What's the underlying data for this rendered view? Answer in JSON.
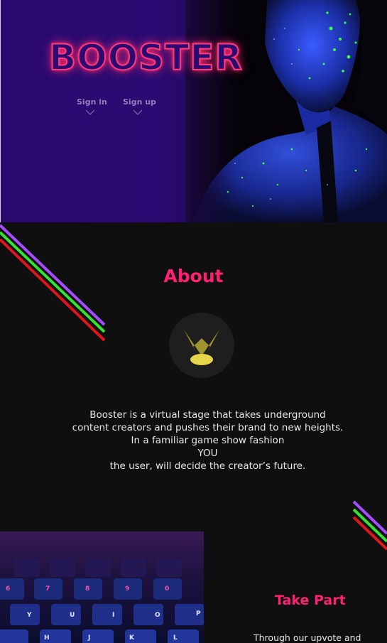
{
  "hero": {
    "logo": "BOOSTER",
    "nav": [
      {
        "label": "Sign in"
      },
      {
        "label": "Sign up"
      }
    ]
  },
  "about": {
    "title": "About",
    "lines": [
      "Booster is a virtual stage that takes underground",
      "content creators and pushes their brand to new heights.",
      "In a familiar game show fashion",
      "YOU",
      "the user, will decide the creator’s future."
    ]
  },
  "take_part": {
    "title": "Take Part",
    "body": "Through our upvote and"
  },
  "keyboard": {
    "keys_row1": [
      "6",
      "7",
      "8",
      "9",
      "0"
    ],
    "keys_row2": [
      "Y",
      "U",
      "I",
      "O",
      "P"
    ],
    "keys_row3": [
      "H",
      "J",
      "K",
      "L"
    ]
  },
  "colors": {
    "accent": "#ff1f73",
    "neon_purple": "#a64cff",
    "neon_green": "#33e233",
    "neon_red": "#e0141e",
    "background": "#0f0f0f"
  }
}
